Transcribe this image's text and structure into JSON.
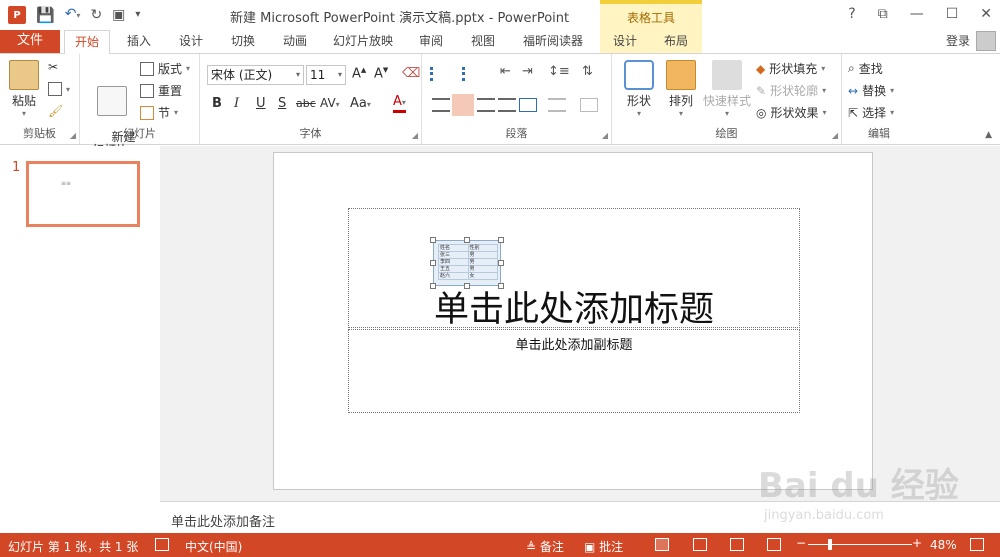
{
  "window": {
    "title": "新建 Microsoft PowerPoint 演示文稿.pptx - PowerPoint",
    "app_logo": "P",
    "context_tools": "表格工具",
    "controls": [
      "?",
      "⧉",
      "—",
      "☐",
      "✕"
    ]
  },
  "tabs": {
    "file": "文件",
    "items": [
      "开始",
      "插入",
      "设计",
      "切换",
      "动画",
      "幻灯片放映",
      "审阅",
      "视图",
      "福昕阅读器",
      "设计",
      "布局"
    ],
    "active_index": 0,
    "login": "登录"
  },
  "ribbon": {
    "clipboard": {
      "paste": "粘贴",
      "label": "剪贴板"
    },
    "slides": {
      "new_slide": "新建\n幻灯片",
      "layout": "版式",
      "reset": "重置",
      "section": "节",
      "label": "幻灯片"
    },
    "font": {
      "font_name": "宋体 (正文)",
      "font_size": "11",
      "label": "字体",
      "buttons": [
        "B",
        "I",
        "U",
        "S",
        "abc",
        "AV",
        "Aa",
        "A"
      ]
    },
    "paragraph": {
      "label": "段落"
    },
    "drawing": {
      "shape": "形状",
      "arrange": "排列",
      "quick_styles": "快速样式",
      "shape_fill": "形状填充",
      "shape_outline": "形状轮廓",
      "shape_effects": "形状效果",
      "label": "绘图"
    },
    "editing": {
      "find": "查找",
      "replace": "替换",
      "select": "选择",
      "label": "编辑"
    }
  },
  "thumbnails": {
    "slide_number": "1"
  },
  "slide": {
    "title_placeholder": "单击此处添加标题",
    "subtitle_placeholder": "单击此处添加副标题",
    "table": [
      [
        "姓名",
        "性别"
      ],
      [
        "张三",
        "男"
      ],
      [
        "李四",
        "男"
      ],
      [
        "王五",
        "男"
      ],
      [
        "赵六",
        "女"
      ]
    ]
  },
  "notes": {
    "placeholder": "单击此处添加备注"
  },
  "status": {
    "slide_info": "幻灯片 第 1 张，共 1 张",
    "language": "中文(中国)",
    "notes_btn": "备注",
    "comments_btn": "批注",
    "zoom": "48%"
  },
  "watermark": {
    "brand": "Bai du 经验",
    "url": "jingyan.baidu.com"
  },
  "colors": {
    "accent": "#d24726",
    "context": "#fff4c2"
  }
}
